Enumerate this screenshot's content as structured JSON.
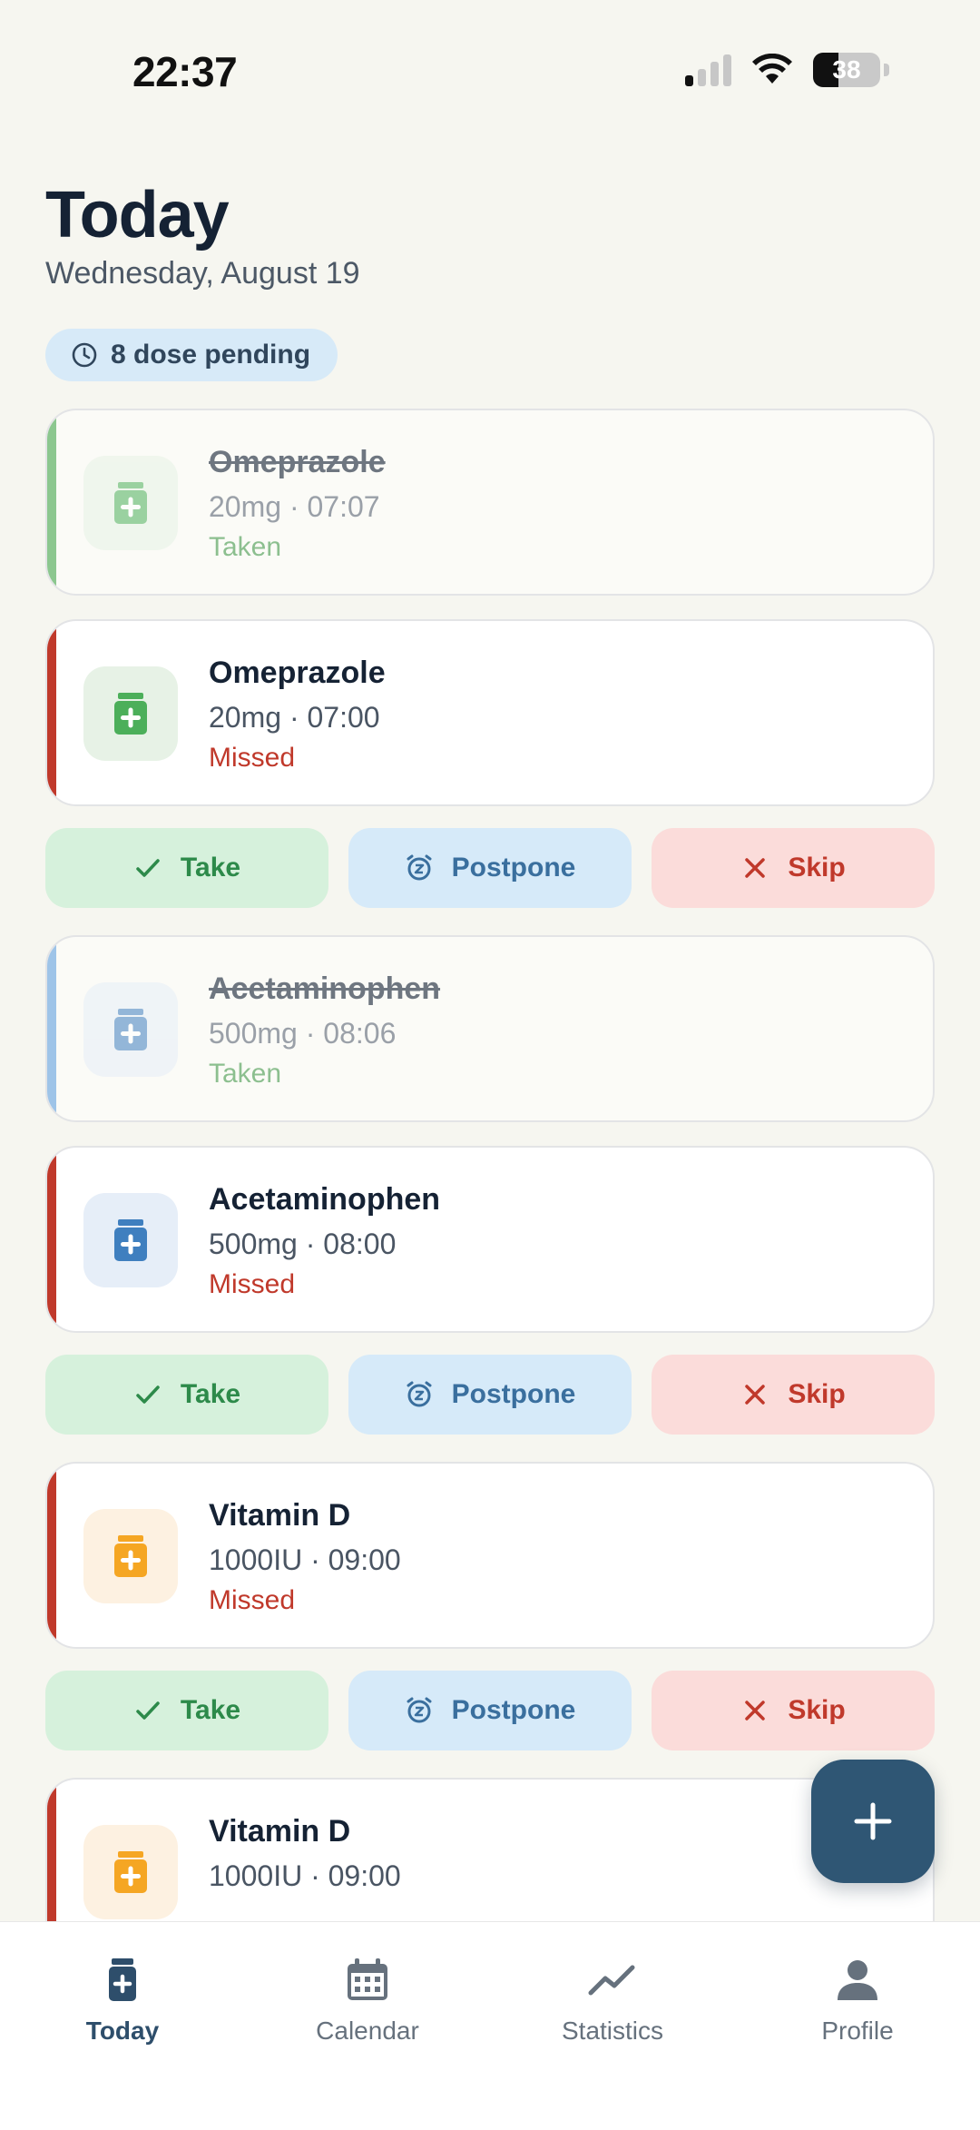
{
  "status_bar": {
    "time": "22:37",
    "battery": "38",
    "battery_level": 0.38
  },
  "header": {
    "title": "Today",
    "subtitle": "Wednesday, August 19",
    "pending_badge": "8 dose pending"
  },
  "colors": {
    "green": "#8cc78f",
    "red": "#c0392b",
    "blue": "#9ec4e8",
    "icon_green": "#4caf5a",
    "icon_blue": "#3f7fbf",
    "icon_orange": "#f5a623",
    "accent": "#2f5674"
  },
  "doses": [
    {
      "name": "Omeprazole",
      "dose": "20mg · 07:07",
      "status": "Taken",
      "state": "taken",
      "stripe": "#8cc78f",
      "icon": "pill-bottle-icon",
      "icon_color": "#4caf5a",
      "icon_bg": "#e7f2e6",
      "actions": null
    },
    {
      "name": "Omeprazole",
      "dose": "20mg · 07:00",
      "status": "Missed",
      "state": "missed",
      "stripe": "#c0392b",
      "icon": "pill-bottle-icon",
      "icon_color": "#4caf5a",
      "icon_bg": "#e7f2e6",
      "actions": true
    },
    {
      "name": "Acetaminophen",
      "dose": "500mg · 08:06",
      "status": "Taken",
      "state": "taken",
      "stripe": "#9ec4e8",
      "icon": "pill-bottle-icon",
      "icon_color": "#3f7fbf",
      "icon_bg": "#e6eef8",
      "actions": null
    },
    {
      "name": "Acetaminophen",
      "dose": "500mg · 08:00",
      "status": "Missed",
      "state": "missed",
      "stripe": "#c0392b",
      "icon": "pill-bottle-icon",
      "icon_color": "#3f7fbf",
      "icon_bg": "#e6eef8",
      "actions": true
    },
    {
      "name": "Vitamin D",
      "dose": "1000IU · 09:00",
      "status": "Missed",
      "state": "missed",
      "stripe": "#c0392b",
      "icon": "pill-bottle-icon",
      "icon_color": "#f5a623",
      "icon_bg": "#fdf1e1",
      "actions": true
    },
    {
      "name": "Vitamin D",
      "dose": "1000IU · 09:00",
      "status": "",
      "state": "missed",
      "stripe": "#c0392b",
      "icon": "pill-bottle-icon",
      "icon_color": "#f5a623",
      "icon_bg": "#fdf1e1",
      "actions": null
    }
  ],
  "action_labels": {
    "take": "Take",
    "postpone": "Postpone",
    "skip": "Skip"
  },
  "fab": {
    "icon": "plus-icon"
  },
  "nav": [
    {
      "label": "Today",
      "icon": "pill-bottle-icon",
      "active": true
    },
    {
      "label": "Calendar",
      "icon": "calendar-icon",
      "active": false
    },
    {
      "label": "Statistics",
      "icon": "trend-icon",
      "active": false
    },
    {
      "label": "Profile",
      "icon": "person-icon",
      "active": false
    }
  ]
}
